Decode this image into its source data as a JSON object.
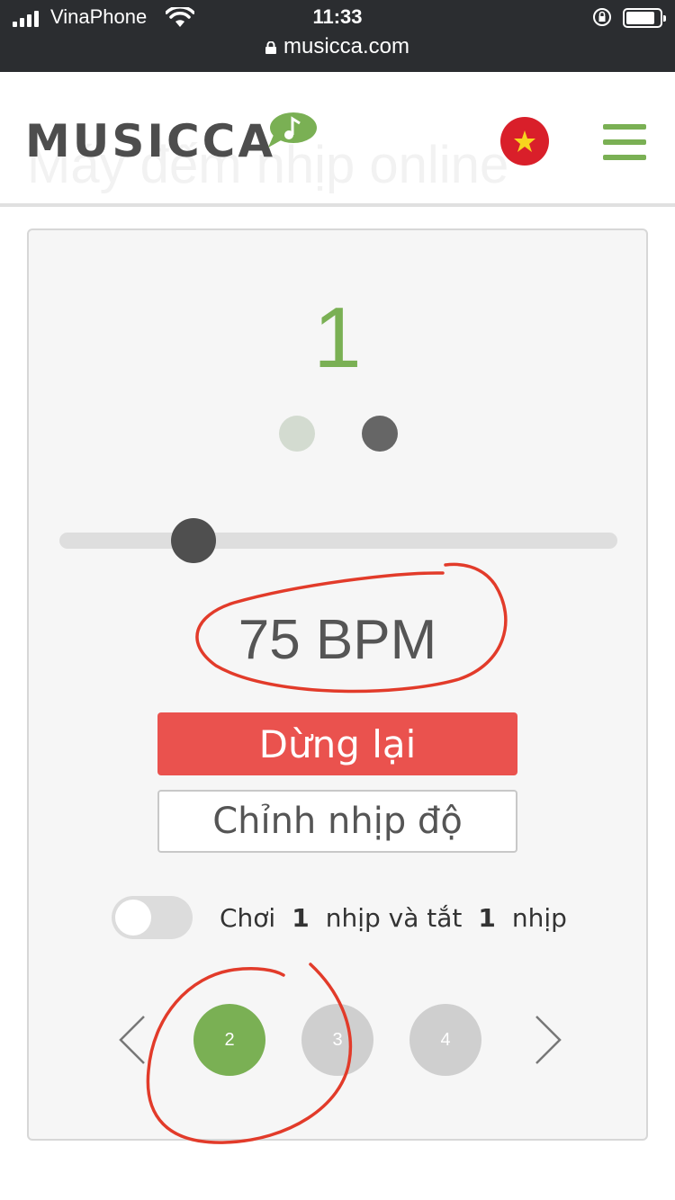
{
  "status_bar": {
    "carrier": "VinaPhone",
    "time": "11:33",
    "url": "musicca.com",
    "battery_level": 0.85
  },
  "header": {
    "logo": "MUSICCA",
    "background_title": "Máy đếm nhịp online",
    "icons": [
      "music-bubble-icon",
      "vietnam-flag-icon",
      "hamburger-menu-icon"
    ]
  },
  "metronome": {
    "current_beat": "1",
    "beat_dots": [
      "inactive",
      "active"
    ],
    "tempo_slider_value": 0.24,
    "bpm_label": "75 BPM",
    "stop_label": "Dừng lại",
    "adjust_tempo_label": "Chỉnh nhịp độ",
    "play_mute": {
      "enabled": false,
      "word_play": "Chơi",
      "play_count": "1",
      "word_mid": "nhịp và tắt",
      "mute_count": "1",
      "word_end": "nhịp"
    },
    "beats_per_measure": {
      "options": [
        "2",
        "3",
        "4"
      ],
      "selected": "2"
    }
  },
  "colors": {
    "accent_green": "#7ab054",
    "stop_red": "#ea524e",
    "annotation_red": "#e23b2a",
    "status_bar_bg": "#2b2d30"
  }
}
